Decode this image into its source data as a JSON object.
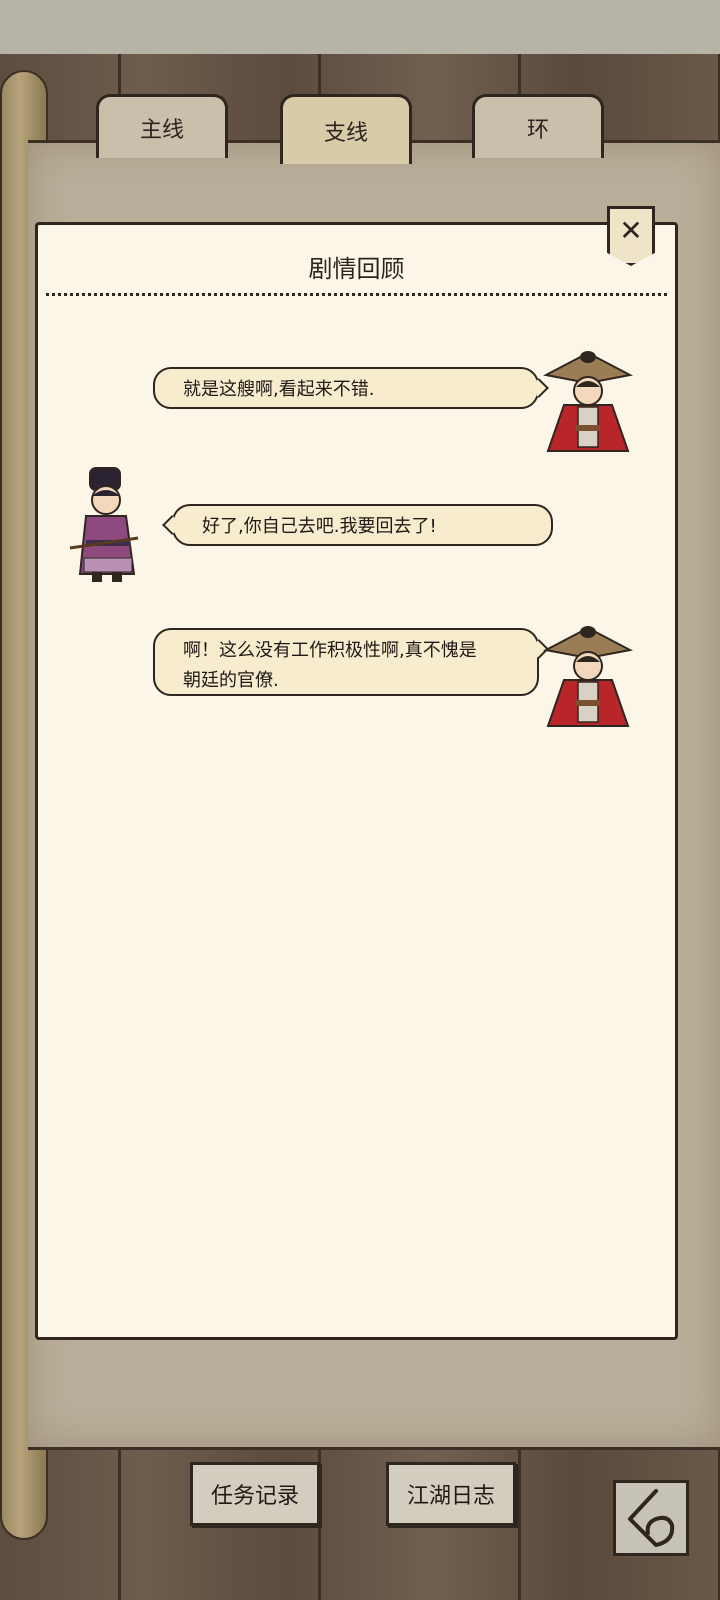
{
  "tabs": [
    {
      "label": "主线",
      "active": false
    },
    {
      "label": "支线",
      "active": true
    },
    {
      "label": "环",
      "active": false
    }
  ],
  "panel": {
    "title": "剧情回顾",
    "close_icon": "close-icon"
  },
  "dialogue": [
    {
      "speaker_side": "right",
      "avatar": "straw-hat-swordsman",
      "lines": [
        "就是这艘啊,看起来不错."
      ]
    },
    {
      "speaker_side": "left",
      "avatar": "official-in-purple-robe",
      "lines": [
        "好了,你自己去吧.我要回去了!"
      ]
    },
    {
      "speaker_side": "right",
      "avatar": "straw-hat-swordsman",
      "lines": [
        "啊！这么没有工作积极性啊,真不愧是",
        "朝廷的官僚."
      ]
    }
  ],
  "footer": {
    "task_log_label": "任务记录",
    "jianghu_journal_label": "江湖日志",
    "back_icon": "back-arrow-icon"
  },
  "colors": {
    "paper": "#fcf6e8",
    "bubble": "#f7ecce",
    "ink": "#2f2620",
    "wood": "#6b5a4a"
  }
}
